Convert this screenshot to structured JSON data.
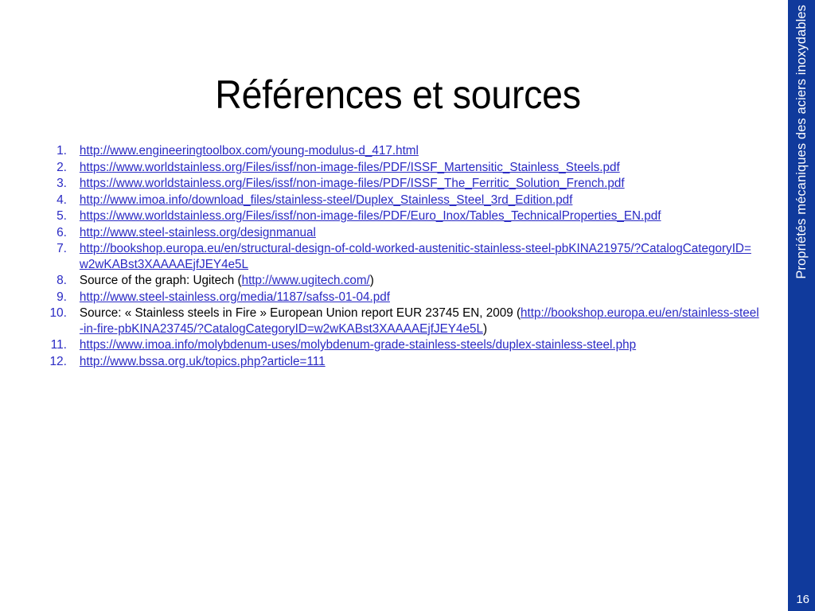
{
  "slide": {
    "title": "Références et sources",
    "page_number": "16",
    "sidebar_title": "Propriétés mécaniques des aciers inoxydables",
    "accent_color": "#103a9c",
    "link_color": "#2a2ac4",
    "text_color": "#000000",
    "background_color": "#ffffff"
  },
  "references": [
    {
      "number": "1.",
      "parts": [
        {
          "type": "link",
          "text": "http://www.engineeringtoolbox.com/young-modulus-d_417.html"
        }
      ]
    },
    {
      "number": "2.",
      "parts": [
        {
          "type": "link",
          "text": "https://www.worldstainless.org/Files/issf/non-image-files/PDF/ISSF_Martensitic_Stainless_Steels.pdf"
        }
      ]
    },
    {
      "number": "3.",
      "parts": [
        {
          "type": "link",
          "text": "https://www.worldstainless.org/Files/issf/non-image-files/PDF/ISSF_The_Ferritic_Solution_French.pdf"
        }
      ]
    },
    {
      "number": "4.",
      "parts": [
        {
          "type": "link",
          "text": "http://www.imoa.info/download_files/stainless-steel/Duplex_Stainless_Steel_3rd_Edition.pdf"
        }
      ]
    },
    {
      "number": "5.",
      "parts": [
        {
          "type": "link",
          "text": "https://www.worldstainless.org/Files/issf/non-image-files/PDF/Euro_Inox/Tables_TechnicalProperties_EN.pdf"
        }
      ]
    },
    {
      "number": "6.",
      "parts": [
        {
          "type": "link",
          "text": "http://www.steel-stainless.org/designmanual"
        }
      ]
    },
    {
      "number": "7.",
      "parts": [
        {
          "type": "link",
          "text": "http://bookshop.europa.eu/en/structural-design-of-cold-worked-austenitic-stainless-steel-pbKINA21975/?CatalogCategoryID=w2wKABst3XAAAAEjfJEY4e5L"
        }
      ]
    },
    {
      "number": "8.",
      "parts": [
        {
          "type": "text",
          "text": "Source of the graph: Ugitech ("
        },
        {
          "type": "link",
          "text": "http://www.ugitech.com/"
        },
        {
          "type": "text",
          "text": ")"
        }
      ]
    },
    {
      "number": "9.",
      "parts": [
        {
          "type": "link",
          "text": "http://www.steel-stainless.org/media/1187/safss-01-04.pdf"
        }
      ]
    },
    {
      "number": "10.",
      "parts": [
        {
          "type": "text",
          "text": "Source: « Stainless steels in Fire »  European Union report  EUR 23745 EN, 2009 ("
        },
        {
          "type": "link",
          "text": "http://bookshop.europa.eu/en/stainless-steel-in-fire-pbKINA23745/?CatalogCategoryID=w2wKABst3XAAAAEjfJEY4e5L"
        },
        {
          "type": "text",
          "text": ")"
        }
      ]
    },
    {
      "number": "11.",
      "parts": [
        {
          "type": "link",
          "text": "https://www.imoa.info/molybdenum-uses/molybdenum-grade-stainless-steels/duplex-stainless-steel.php"
        }
      ]
    },
    {
      "number": "12.",
      "parts": [
        {
          "type": "link",
          "text": "http://www.bssa.org.uk/topics.php?article=111"
        }
      ]
    }
  ]
}
